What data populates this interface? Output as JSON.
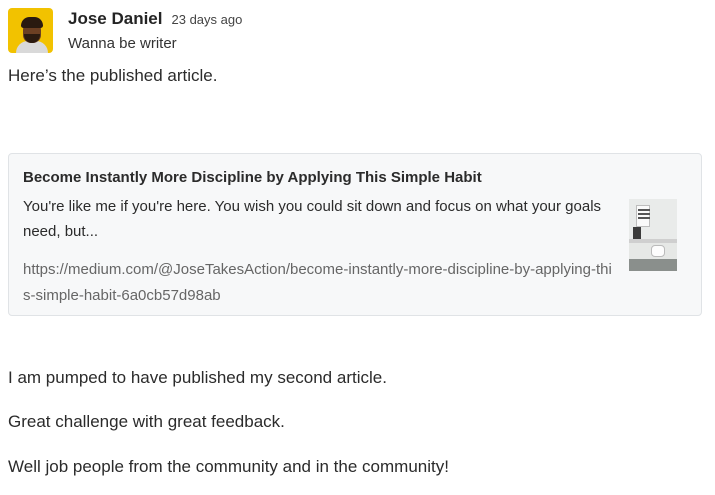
{
  "post": {
    "author_name": "Jose Daniel",
    "time_ago": "23 days ago",
    "author_role": "Wanna be writer",
    "intro": "Here’s the published article.",
    "paragraphs": [
      "I am pumped to have published my second article.",
      "Great challenge with great feedback.",
      "Well job people from the community and in the community!"
    ]
  },
  "link_preview": {
    "title": "Become Instantly More Discipline by Applying This Simple Habit",
    "description": "You're like me if you're here. You wish you could sit down and focus on what your goals need, but...",
    "url": "https://medium.com/@JoseTakesAction/become-instantly-more-discipline-by-applying-this-simple-habit-6a0cb57d98ab",
    "thumbnail_icon": "article-thumbnail-image"
  },
  "colors": {
    "card_background": "#f7f8f9",
    "card_border": "#e0e3e6",
    "avatar_background": "#f2c200",
    "url_text": "#666666"
  }
}
